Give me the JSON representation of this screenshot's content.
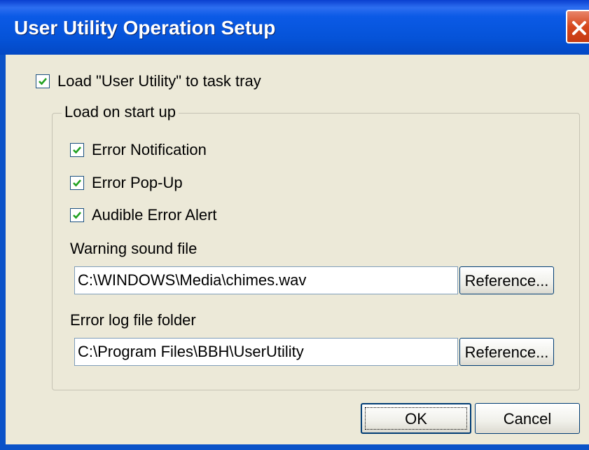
{
  "window": {
    "title": "User Utility Operation Setup"
  },
  "main": {
    "load_to_tray": {
      "label": "Load \"User Utility\" to task tray",
      "checked": true
    }
  },
  "group": {
    "title": "Load on start up",
    "options": [
      {
        "label": "Error Notification",
        "checked": true
      },
      {
        "label": "Error Pop-Up",
        "checked": true
      },
      {
        "label": "Audible Error Alert",
        "checked": true
      }
    ],
    "warning_sound": {
      "label": "Warning sound file",
      "value": "C:\\WINDOWS\\Media\\chimes.wav",
      "button": "Reference..."
    },
    "error_log": {
      "label": "Error log file folder",
      "value": "C:\\Program Files\\BBH\\UserUtility",
      "button": "Reference..."
    }
  },
  "footer": {
    "ok": "OK",
    "cancel": "Cancel"
  },
  "colors": {
    "title_bar": "#0553d8",
    "dialog_face": "#ece9d8",
    "close_button": "#d6471c"
  },
  "icons": {
    "close": "close-icon",
    "check": "checkmark-icon"
  }
}
